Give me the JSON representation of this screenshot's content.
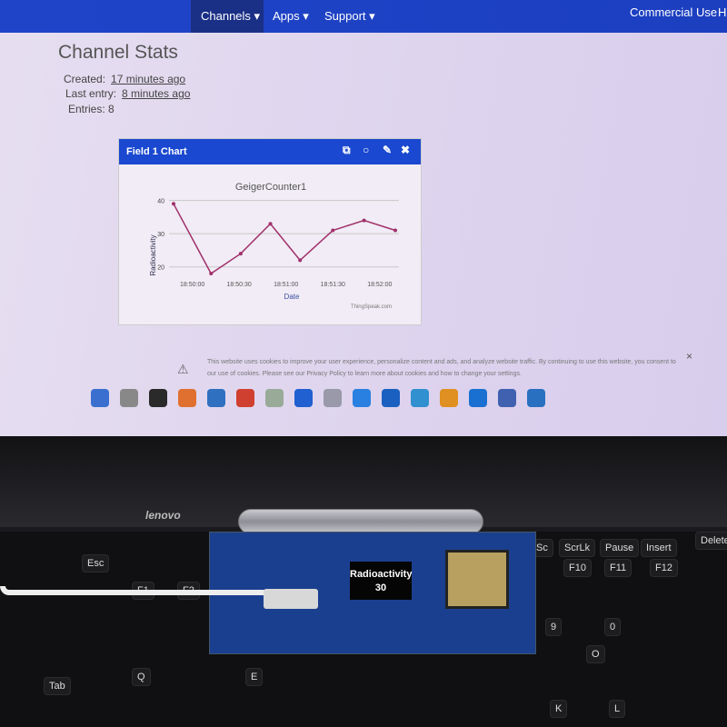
{
  "nav": {
    "items": [
      "Channels ▾",
      "Apps ▾",
      "Support ▾"
    ],
    "right": "Commercial Use",
    "right_cut": "H"
  },
  "page": {
    "title": "Channel Stats",
    "created_label": "Created:",
    "created": "17 minutes ago",
    "last_label": "Last entry:",
    "last": "8 minutes ago",
    "entries": "Entries: 8"
  },
  "panel": {
    "title": "Field 1 Chart",
    "icons": [
      "external-link-icon",
      "comment-icon",
      "pencil-icon",
      "close-icon"
    ]
  },
  "chart_data": {
    "type": "line",
    "title": "GeigerCounter1",
    "xlabel": "Date",
    "ylabel": "Radioactivity",
    "credit": "ThingSpeak.com",
    "x": [
      "18:49:48",
      "18:50:12",
      "18:50:31",
      "18:50:50",
      "18:51:09",
      "18:51:30",
      "18:51:50",
      "18:52:10"
    ],
    "values": [
      39,
      18,
      24,
      33,
      22,
      31,
      34,
      31
    ],
    "xticks": [
      "18:50:00",
      "18:50:30",
      "18:51:00",
      "18:51:30",
      "18:52:00"
    ],
    "yticks": [
      20,
      30,
      40
    ],
    "ylim": [
      18,
      41
    ],
    "grid": true,
    "color": "#a0306a"
  },
  "cookie": {
    "text": "This website uses cookies to improve your user experience, personalize content and ads, and analyze website traffic. By continuing to use this website, you consent to our use of cookies. Please see our Privacy Policy to learn more about cookies and how to change your settings.",
    "close": "×"
  },
  "laptop": {
    "brand": "lenovo"
  },
  "device": {
    "display_label": "Radioactivity",
    "display_value": "30"
  },
  "keys": [
    "Esc",
    "F1",
    "F2",
    "PrtSc",
    "ScrLk",
    "Pause",
    "Insert",
    "Delete",
    "F10",
    "F11",
    "F12",
    "Tab",
    "Q",
    "E",
    "K",
    "L",
    "O",
    "9",
    "0"
  ]
}
